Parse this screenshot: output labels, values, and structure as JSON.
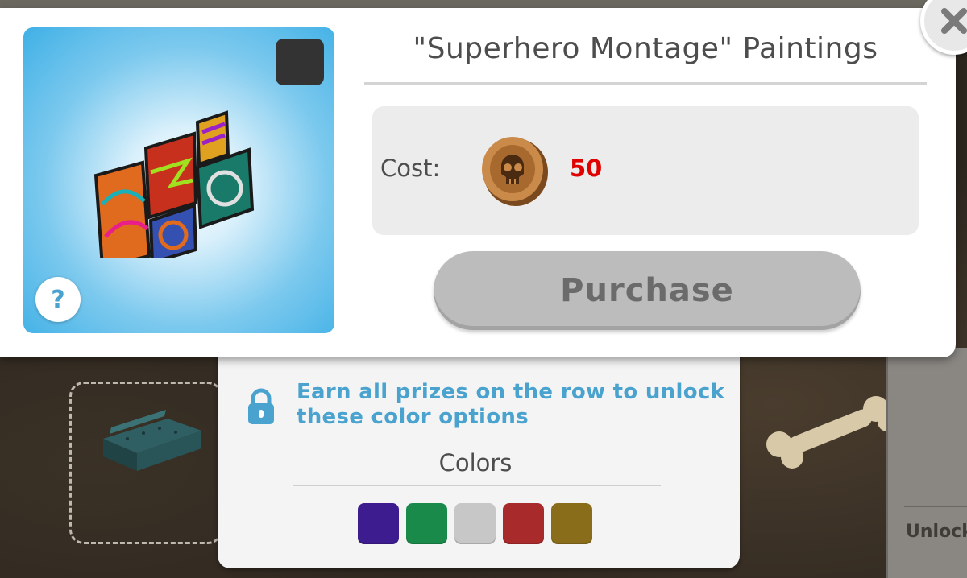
{
  "modal": {
    "title": "\"Superhero Montage\" Paintings",
    "cost_label": "Cost:",
    "cost_value": "50",
    "cost_color": "#e00000",
    "currency_icon": "skull-coin-icon",
    "purchase_label": "Purchase",
    "purchase_enabled": false,
    "selected_color": "#333333",
    "help_label": "?"
  },
  "colors_panel": {
    "unlock_message": "Earn all prizes on the row to unlock these color options",
    "title": "Colors",
    "swatches": [
      {
        "name": "purple",
        "color": "#3d1c8f"
      },
      {
        "name": "green",
        "color": "#1a8a4a"
      },
      {
        "name": "light-gray",
        "color": "#c7c7c7"
      },
      {
        "name": "red",
        "color": "#a82a2a"
      },
      {
        "name": "gold",
        "color": "#8a6d1a"
      }
    ]
  },
  "background": {
    "side_panel_label": "Unlock"
  }
}
